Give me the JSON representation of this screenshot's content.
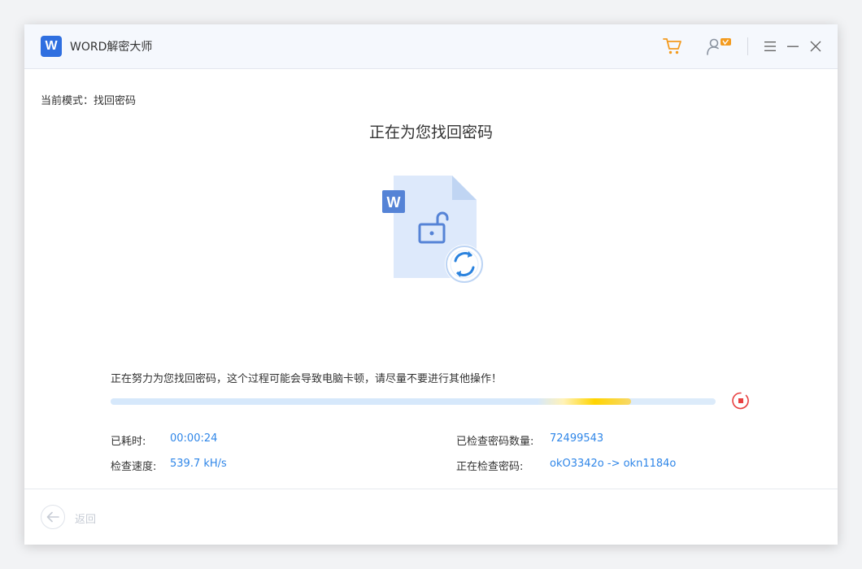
{
  "app": {
    "logo_letter": "W",
    "title": "WORD解密大师"
  },
  "titlebar": {
    "icons": [
      "cart-icon",
      "user-vip-icon",
      "menu-icon",
      "minimize-icon",
      "close-icon"
    ]
  },
  "mode": {
    "text": "当前模式：找回密码"
  },
  "main": {
    "title": "正在为您找回密码",
    "status_message": "正在努力为您找回密码，这个过程可能会导致电脑卡顿，请尽量不要进行其他操作！",
    "progress_fraction": 0.86
  },
  "stats": {
    "elapsed_label": "已耗时:",
    "elapsed_value": "00:00:24",
    "speed_label": "检查速度:",
    "speed_value": "539.7 kH/s",
    "checked_label": "已检查密码数量:",
    "checked_value": "72499543",
    "current_label": "正在检查密码:",
    "current_value": "okO3342o -> okn1184o"
  },
  "footer": {
    "back_label": "返回"
  },
  "colors": {
    "accent": "#2f86e8",
    "brand": "#2f6fe0",
    "cart": "#f39b1f",
    "stop": "#e84040"
  }
}
